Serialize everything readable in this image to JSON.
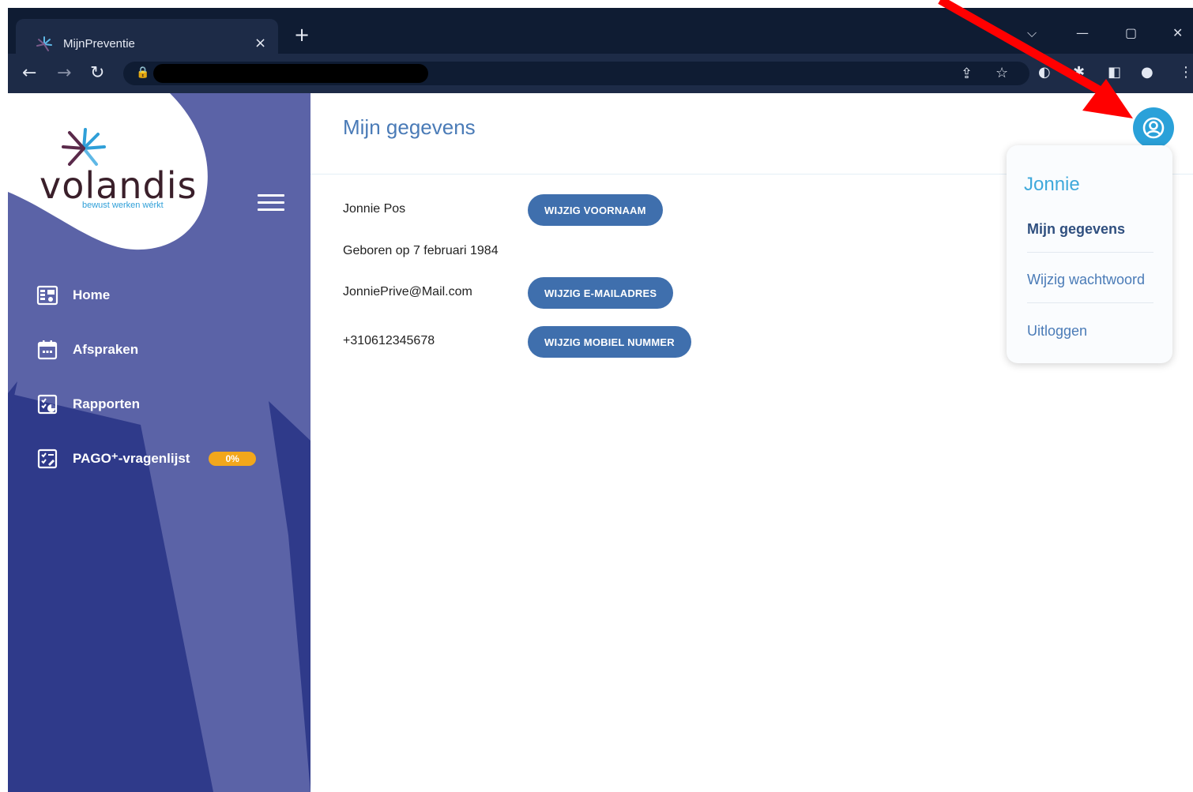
{
  "browser": {
    "tab_title": "MijnPreventie",
    "tab_close": "×",
    "new_tab": "+",
    "window_controls": [
      "⌵",
      "—",
      "▢",
      "✕"
    ]
  },
  "colors": {
    "sidebar": "#5b63a7",
    "accent": "#3f6fad",
    "avatar": "#2aa1d9",
    "badge": "#f2a71b",
    "annotation_arrow": "#ff0000"
  },
  "logo": {
    "name": "volandis",
    "tagline": "bewust werken wérkt"
  },
  "sidebar": {
    "items": [
      {
        "label": "Home",
        "icon": "home-icon"
      },
      {
        "label": "Afspraken",
        "icon": "calendar-icon"
      },
      {
        "label": "Rapporten",
        "icon": "report-icon"
      },
      {
        "label": "PAGO⁺-vragenlijst",
        "icon": "questionnaire-icon",
        "badge": "0%"
      }
    ]
  },
  "main": {
    "title": "Mijn gegevens",
    "name": "Jonnie Pos",
    "birth": "Geboren op 7 februari 1984",
    "email": "JonniePrive@Mail.com",
    "phone": "+310612345678",
    "buttons": {
      "edit_firstname": "WIJZIG VOORNAAM",
      "edit_email": "WIJZIG E-MAILADRES",
      "edit_mobile": "WIJZIG MOBIEL NUMMER"
    }
  },
  "user_menu": {
    "username": "Jonnie",
    "items": [
      "Mijn gegevens",
      "Wijzig wachtwoord",
      "Uitloggen"
    ]
  }
}
